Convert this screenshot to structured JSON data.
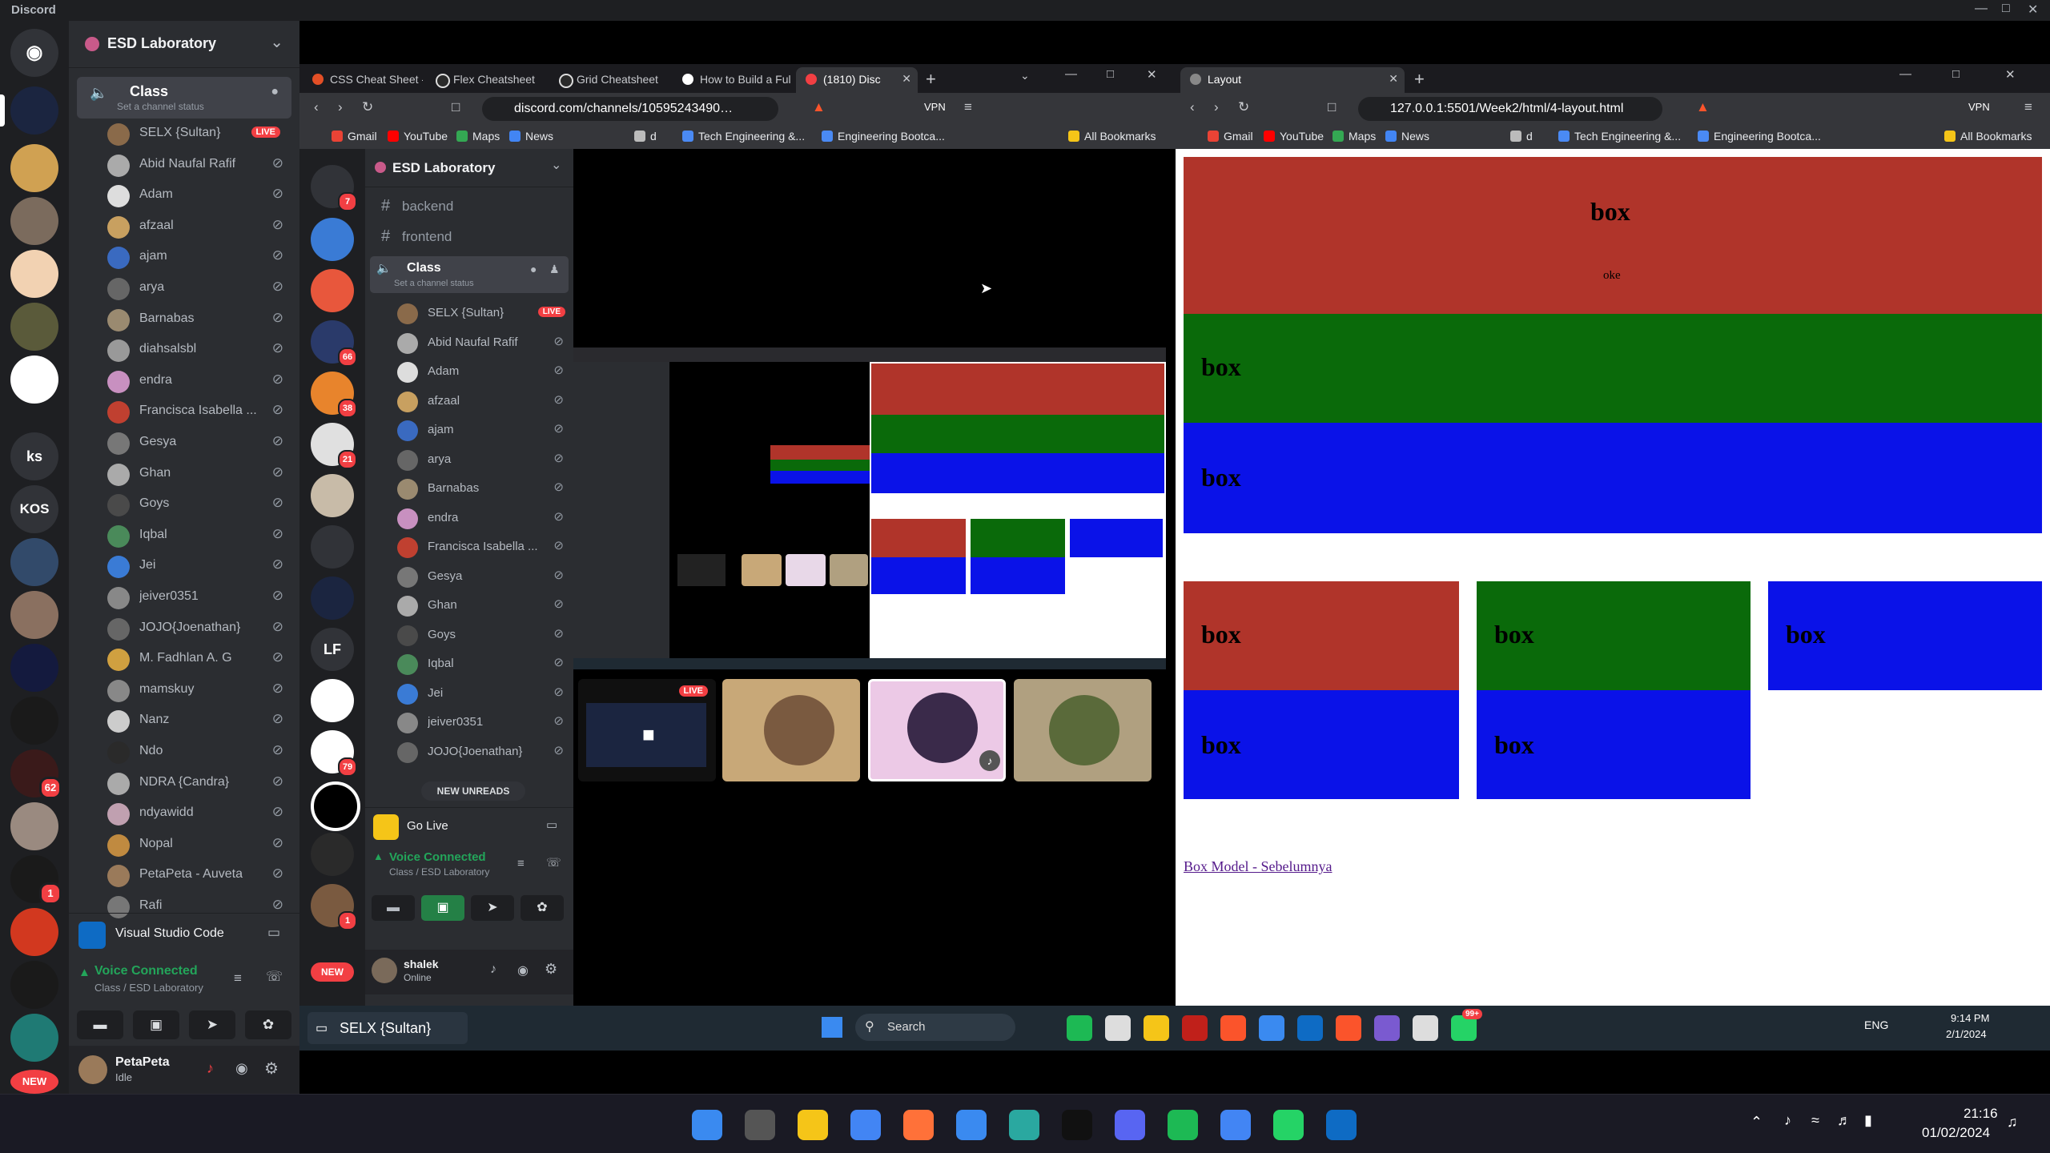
{
  "titlebar": {
    "name": "Discord"
  },
  "outer_discord": {
    "server_name": "ESD Laboratory",
    "voice_channel": {
      "name": "Class",
      "status": "Set a channel status"
    },
    "members": [
      {
        "name": "SELX {Sultan}",
        "live": "LIVE"
      },
      {
        "name": "Abid Naufal Rafif"
      },
      {
        "name": "Adam"
      },
      {
        "name": "afzaal"
      },
      {
        "name": "ajam"
      },
      {
        "name": "arya"
      },
      {
        "name": "Barnabas"
      },
      {
        "name": "diahsalsbl"
      },
      {
        "name": "endra"
      },
      {
        "name": "Francisca Isabella ..."
      },
      {
        "name": "Gesya"
      },
      {
        "name": "Ghan"
      },
      {
        "name": "Goys"
      },
      {
        "name": "Iqbal"
      },
      {
        "name": "Jei"
      },
      {
        "name": "jeiver0351"
      },
      {
        "name": "JOJO{Joenathan}"
      },
      {
        "name": "M. Fadhlan A. G"
      },
      {
        "name": "mamskuy"
      },
      {
        "name": "Nanz"
      },
      {
        "name": "Ndo"
      },
      {
        "name": "NDRA {Candra}"
      },
      {
        "name": "ndyawidd"
      },
      {
        "name": "Nopal"
      },
      {
        "name": "PetaPeta - Auveta"
      },
      {
        "name": "Rafi"
      }
    ],
    "activity": {
      "name": "Visual Studio Code"
    },
    "voice_connected": {
      "title": "Voice Connected",
      "sub": "Class / ESD Laboratory"
    },
    "user": {
      "name": "PetaPeta",
      "status": "Idle"
    },
    "guild_labels": {
      "ks": "ks",
      "kos": "KOS",
      "new": "NEW"
    },
    "guild_badges": {
      "b1": "62",
      "b2": "1"
    }
  },
  "left_browser": {
    "tabs": [
      {
        "label": "CSS Cheat Sheet -"
      },
      {
        "label": "Flex Cheatsheet"
      },
      {
        "label": "Grid Cheatsheet"
      },
      {
        "label": "How to Build a Ful"
      },
      {
        "label": "(1810) Disc"
      }
    ],
    "url": "discord.com/channels/10595243490…",
    "bookmarks": [
      "Gmail",
      "YouTube",
      "Maps",
      "News",
      "d",
      "Tech Engineering &...",
      "Engineering Bootca..."
    ],
    "all_bookmarks": "All Bookmarks",
    "vpn": "VPN"
  },
  "inner_discord": {
    "server_name": "ESD Laboratory",
    "channels": [
      "backend",
      "frontend"
    ],
    "voice_channel": {
      "name": "Class",
      "status": "Set a channel status"
    },
    "members": [
      {
        "name": "SELX {Sultan}",
        "live": "LIVE"
      },
      {
        "name": "Abid Naufal Rafif"
      },
      {
        "name": "Adam"
      },
      {
        "name": "afzaal"
      },
      {
        "name": "ajam"
      },
      {
        "name": "arya"
      },
      {
        "name": "Barnabas"
      },
      {
        "name": "endra"
      },
      {
        "name": "Francisca Isabella ..."
      },
      {
        "name": "Gesya"
      },
      {
        "name": "Ghan"
      },
      {
        "name": "Goys"
      },
      {
        "name": "Iqbal"
      },
      {
        "name": "Jei"
      },
      {
        "name": "jeiver0351"
      },
      {
        "name": "JOJO{Joenathan}"
      }
    ],
    "new_unreads": "NEW UNREADS",
    "go_live": "Go Live",
    "voice_connected": {
      "title": "Voice Connected",
      "sub": "Class / ESD Laboratory"
    },
    "user": {
      "name": "shalek",
      "status": "Online"
    },
    "guild_badges": [
      "7",
      "66",
      "38",
      "21",
      "79",
      "1"
    ],
    "lf": "LF",
    "new": "NEW",
    "stream_live": "LIVE"
  },
  "right_browser": {
    "tab": "Layout",
    "url": "127.0.0.1:5501/Week2/html/4-layout.html",
    "bookmarks": [
      "Gmail",
      "YouTube",
      "Maps",
      "News",
      "d",
      "Tech Engineering &...",
      "Engineering Bootca..."
    ],
    "all_bookmarks": "All Bookmarks",
    "vpn": "VPN",
    "page": {
      "box_label": "box",
      "oke": "oke",
      "link": "Box Model - Sebelumnya"
    }
  },
  "inner_taskbar": {
    "search": "Search",
    "stream_label": "SELX {Sultan}",
    "lang": "ENG",
    "time": "9:14 PM",
    "date": "2/1/2024",
    "badge": "99+"
  },
  "taskbar": {
    "time": "21:16",
    "date": "01/02/2024"
  },
  "colors": {
    "red": "#b0342a",
    "green": "#0a6a0a",
    "blue": "#0a12e8",
    "voice": "#23a55a",
    "live": "#f23f43"
  }
}
